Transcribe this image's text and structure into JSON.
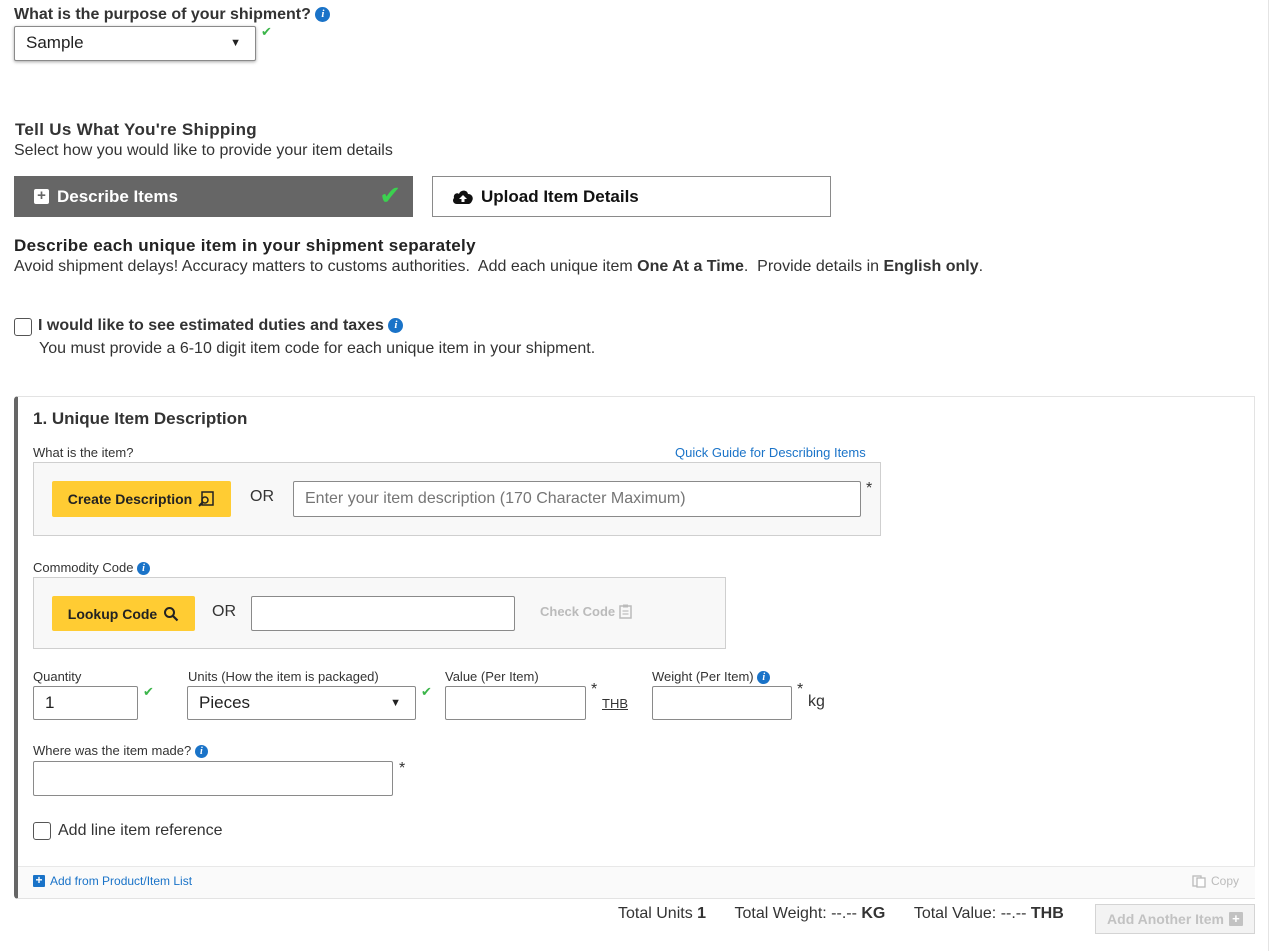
{
  "purpose": {
    "label": "What is the purpose of your shipment?",
    "value": "Sample"
  },
  "shipping": {
    "title": "Tell Us What You're Shipping",
    "subtitle": "Select how you would like to provide your item details",
    "describe_label": "Describe Items",
    "upload_label": "Upload Item Details"
  },
  "describe": {
    "heading": "Describe each unique item in your shipment separately",
    "note_part1": "Avoid shipment delays! Accuracy matters to customs authorities.  Add each unique item ",
    "note_bold1": "One At a Time",
    "note_part2": ".  Provide details in ",
    "note_bold2": "English only",
    "note_part3": "."
  },
  "duties": {
    "label": "I would like to see estimated duties and taxes",
    "note": "You must provide a 6-10 digit item code for each unique item in your shipment."
  },
  "item": {
    "title": "1. Unique Item Description",
    "what_label": "What is the item?",
    "quick_guide": "Quick Guide for Describing Items",
    "create_btn": "Create Description",
    "or1": "OR",
    "desc_placeholder": "Enter your item description (170 Character Maximum)",
    "commodity_label": "Commodity Code",
    "lookup_btn": "Lookup Code",
    "or2": "OR",
    "check_code": "Check Code",
    "quantity_label": "Quantity",
    "quantity_value": "1",
    "units_label": "Units (How the item is packaged)",
    "units_value": "Pieces",
    "value_label": "Value (Per Item)",
    "currency": "THB",
    "weight_label": "Weight (Per Item)",
    "weight_unit": "kg",
    "made_label": "Where was the item made?",
    "reference_label": "Add line item reference",
    "add_from_list": "Add from Product/Item List",
    "copy": "Copy",
    "asterisk": "*"
  },
  "totals": {
    "units_label": "Total Units",
    "units_value": "1",
    "weight_label": "Total Weight: --.--",
    "weight_unit": "KG",
    "value_label": "Total Value: --.--",
    "value_unit": "THB",
    "add_another": "Add Another Item"
  },
  "colors": {
    "accent_yellow": "#ffcc33",
    "selected_tab": "#666666",
    "link_blue": "#1a73c8",
    "check_green": "#3bb54a"
  }
}
